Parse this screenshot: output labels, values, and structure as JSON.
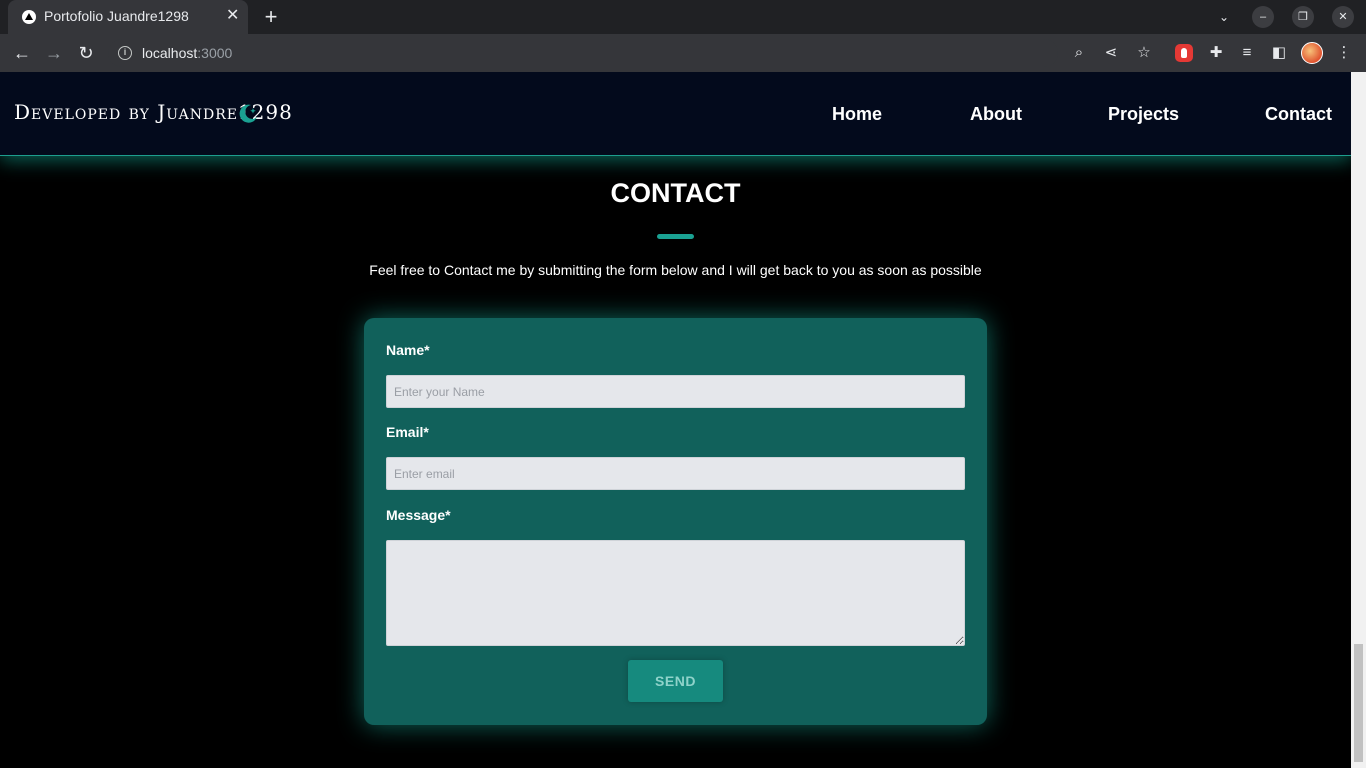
{
  "browser": {
    "tab_title": "Portofolio Juandre1298",
    "tab_close": "✕",
    "new_tab": "+",
    "url_host": "localhost",
    "url_port": ":3000",
    "controls": {
      "minimize": "–",
      "restore": "❐",
      "close": "✕",
      "tab_search": "⌄"
    },
    "nav": {
      "back": "←",
      "forward": "→",
      "reload": "↻"
    },
    "toolbar_icons": {
      "zoom": "⌕",
      "share": "⋖",
      "bookmark": "☆",
      "extensions": "✚",
      "reading_list": "≡",
      "side_panel": "◧",
      "menu": "⋮"
    }
  },
  "site": {
    "brand": "Developed by Juandre1298",
    "brand_icon": "moon-icon",
    "accent_color": "#1aa192",
    "nav": [
      {
        "label": "Home"
      },
      {
        "label": "About"
      },
      {
        "label": "Projects"
      },
      {
        "label": "Contact"
      }
    ]
  },
  "contact": {
    "title": "CONTACT",
    "subtitle": "Feel free to Contact me by submitting the form below and I will get back to you as soon as possible",
    "form": {
      "name_label": "Name*",
      "name_placeholder": "Enter your Name",
      "email_label": "Email*",
      "email_placeholder": "Enter email",
      "message_label": "Message*",
      "message_value": "",
      "send_label": "SEND"
    }
  }
}
